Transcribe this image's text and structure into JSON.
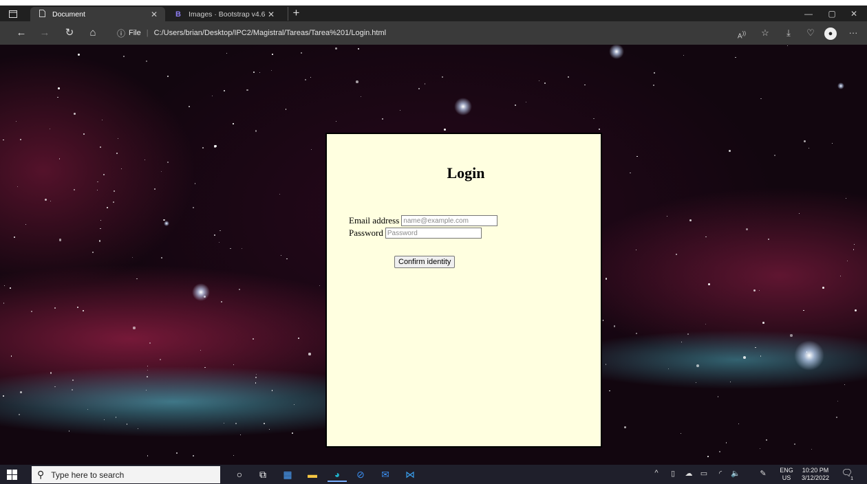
{
  "browser": {
    "tabs": [
      {
        "title": "Document",
        "icon": "document-icon",
        "active": true
      },
      {
        "title": "Images · Bootstrap v4.6",
        "icon": "bootstrap-icon",
        "active": false
      }
    ],
    "new_tab_glyph": "+",
    "address": {
      "info_label": "File",
      "url": "C:/Users/brian/Desktop/IPC2/Magistral/Tareas/Tarea%201/Login.html"
    }
  },
  "login": {
    "title": "Login",
    "email_label": "Email address",
    "email_placeholder": "name@example.com",
    "password_label": "Password",
    "password_placeholder": "Password",
    "confirm_label": "Confirm identity",
    "card_background": "#ffffe0"
  },
  "taskbar": {
    "search_placeholder": "Type here to search",
    "lang_top": "ENG",
    "lang_bottom": "US",
    "time": "10:20 PM",
    "date": "3/12/2022",
    "notification_count": "1"
  }
}
